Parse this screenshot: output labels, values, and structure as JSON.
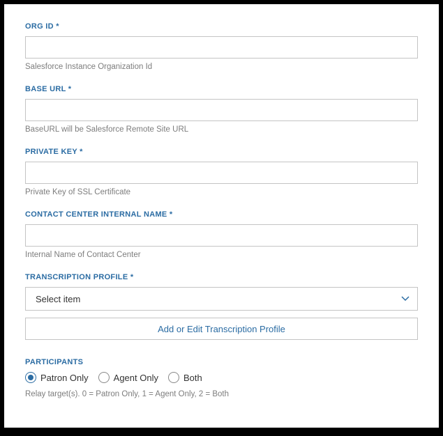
{
  "fields": {
    "org_id": {
      "label": "ORG ID *",
      "value": "",
      "help": "Salesforce Instance Organization Id"
    },
    "base_url": {
      "label": "BASE URL *",
      "value": "",
      "help": "BaseURL will be Salesforce Remote Site URL"
    },
    "private_key": {
      "label": "PRIVATE KEY *",
      "value": "",
      "help": "Private Key of SSL Certificate"
    },
    "contact_center": {
      "label": "CONTACT CENTER INTERNAL NAME *",
      "value": "",
      "help": "Internal Name of Contact Center"
    },
    "transcription_profile": {
      "label": "TRANSCRIPTION PROFILE *",
      "selected": "Select item",
      "button": "Add or Edit Transcription Profile"
    }
  },
  "participants": {
    "label": "PARTICIPANTS",
    "options": [
      {
        "label": "Patron Only",
        "checked": true
      },
      {
        "label": "Agent Only",
        "checked": false
      },
      {
        "label": "Both",
        "checked": false
      }
    ],
    "help": "Relay target(s). 0 = Patron Only, 1 = Agent Only, 2 = Both"
  }
}
